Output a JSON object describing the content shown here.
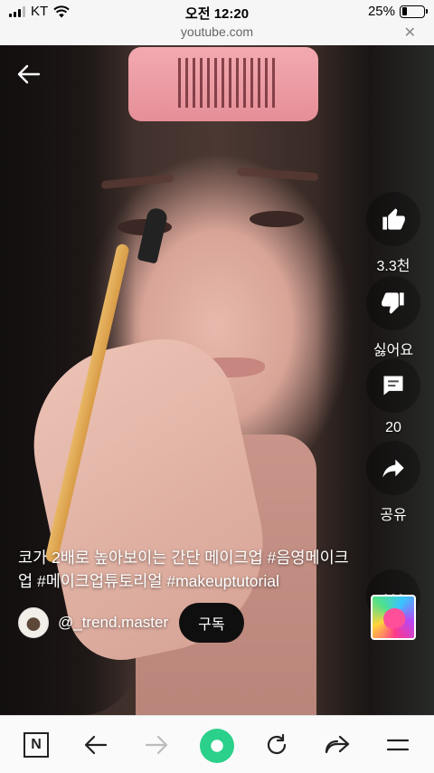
{
  "status_bar": {
    "carrier": "KT",
    "time": "오전 12:20",
    "battery_percent": "25%",
    "battery_level": 0.25
  },
  "url_bar": {
    "url": "youtube.com",
    "close_glyph": "✕"
  },
  "video": {
    "back_icon": "back-arrow-icon"
  },
  "actions": {
    "like": {
      "icon": "thumbs-up-icon",
      "label": "3.3천"
    },
    "dislike": {
      "icon": "thumbs-down-icon",
      "label": "싫어요"
    },
    "comments": {
      "icon": "comment-icon",
      "label": "20"
    },
    "share": {
      "icon": "share-icon",
      "label": "공유"
    },
    "more": {
      "icon": "more-icon"
    }
  },
  "caption": "코가 2배로 높아보이는 간단 메이크업 #음영메이크업 #메이크업튜토리얼 #makeuptutorial",
  "channel": {
    "name": "@_trend.master",
    "subscribe_label": "구독"
  },
  "toolbar": {
    "n_label": "N",
    "icons": [
      "n-icon",
      "back-icon",
      "forward-icon",
      "home-icon",
      "refresh-icon",
      "share-icon",
      "menu-icon"
    ]
  },
  "colors": {
    "subscribe_bg": "#0f0f0f",
    "home_green": "#2bd08a",
    "toolbar_bg": "#fafafa"
  }
}
